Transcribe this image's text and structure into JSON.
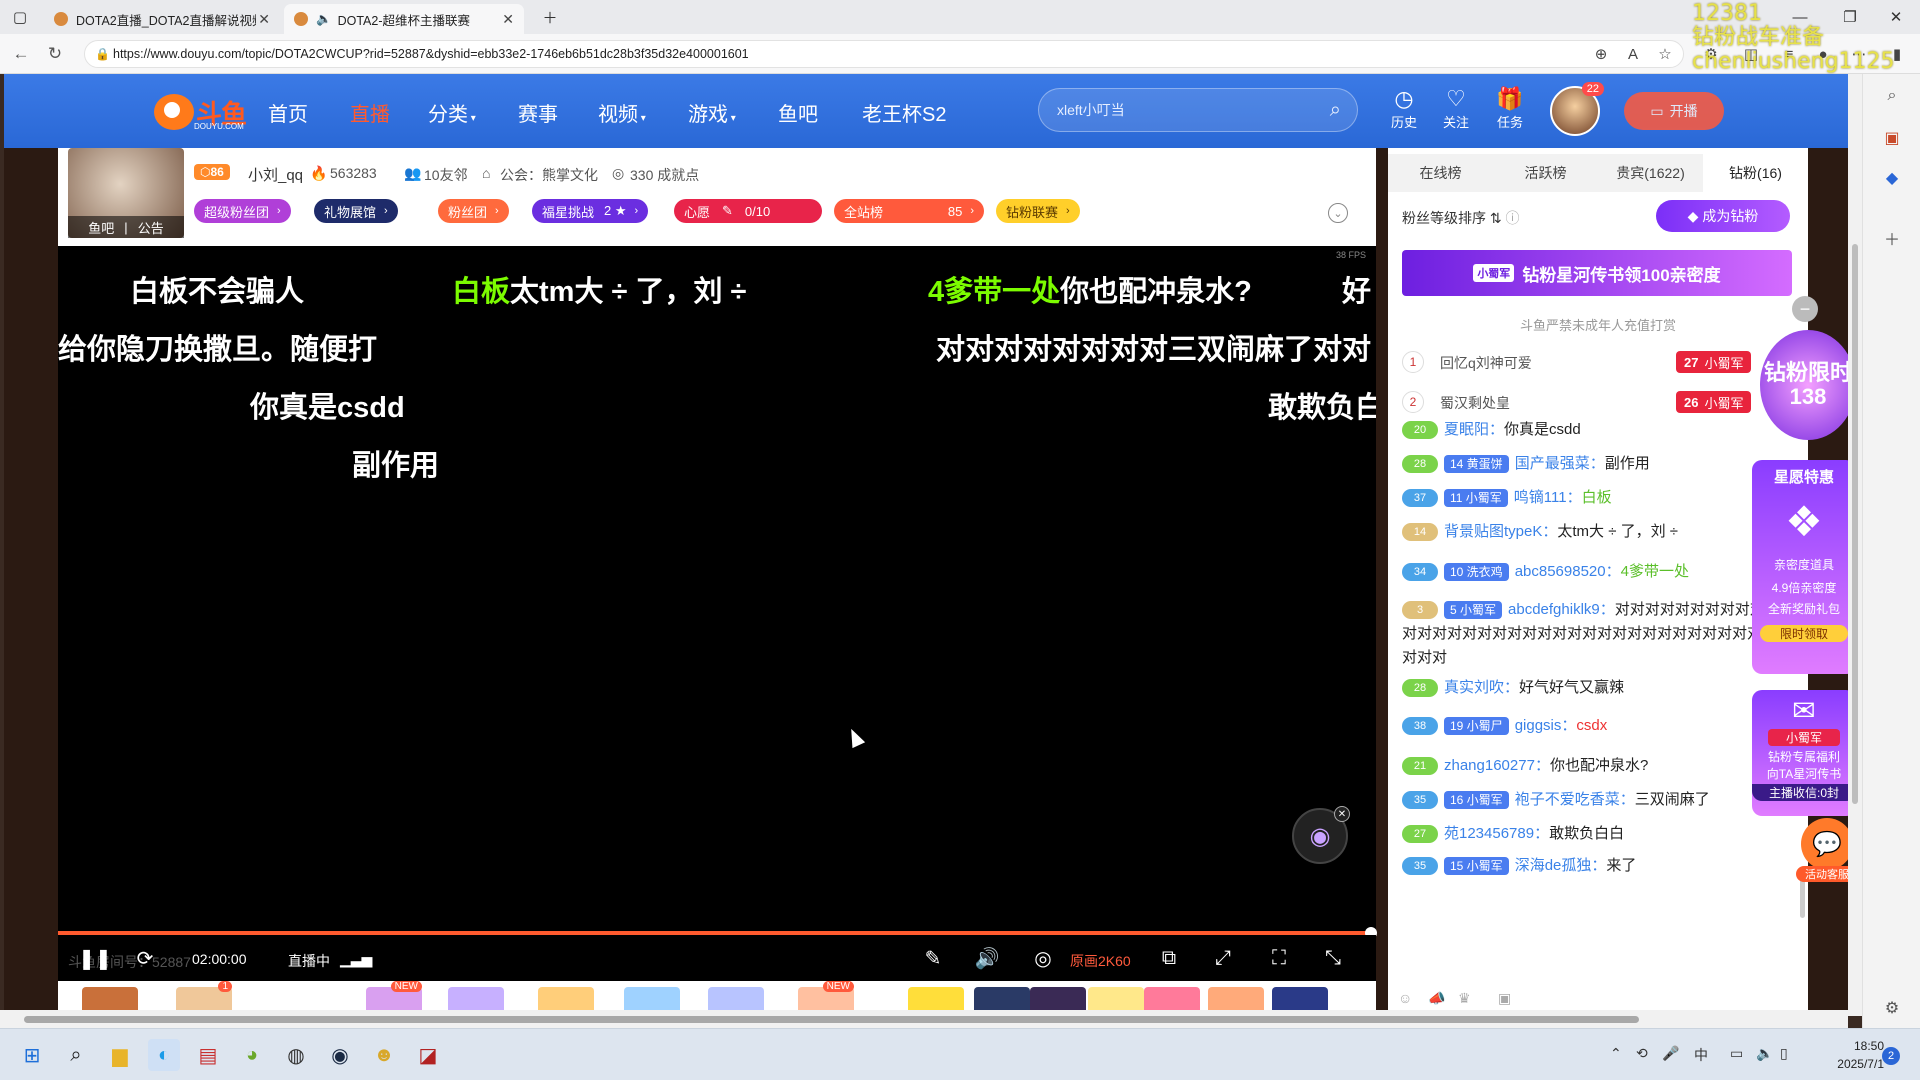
{
  "browser": {
    "tabs": [
      {
        "title": "DOTA2直播_DOTA2直播解说视频",
        "active": false
      },
      {
        "title": "DOTA2-超维杯主播联赛",
        "active": true
      }
    ],
    "url": "https://www.douyu.com/topic/DOTA2CWCUP?rid=52887&dyshid=ebb33e2-1746eb6b51dc28b3f35d32e400001601",
    "overlay_text": [
      "12381",
      "钻粉战车准备",
      "chenliusheng1125"
    ]
  },
  "header": {
    "logo": "斗鱼",
    "logo_sub": "DOUYU.COM",
    "nav": [
      "首页",
      "直播",
      "分类",
      "赛事",
      "视频",
      "游戏",
      "鱼吧",
      "老王杯S2"
    ],
    "active_nav": "直播",
    "search_placeholder": "xleft小叮当",
    "icons": [
      {
        "label": "历史",
        "icon": "clock-icon"
      },
      {
        "label": "关注",
        "icon": "heart-icon"
      },
      {
        "label": "任务",
        "icon": "gift-icon"
      }
    ],
    "avatar_badge": "22",
    "live_button": "开播"
  },
  "room": {
    "avatar_bar": [
      "鱼吧",
      "公告"
    ],
    "level": "86",
    "host": "小刘_qq",
    "hot": "563283",
    "neighbors": "10友邻",
    "guild": "公会：熊掌文化",
    "achievements": "330 成就点",
    "pills": [
      {
        "label": "超级粉丝团",
        "color": "#b03fd8"
      },
      {
        "label": "礼物展馆",
        "color": "#1e2b6a"
      },
      {
        "label": "粉丝团",
        "color": "#ff6a3d"
      },
      {
        "label": "福星挑战",
        "extra": "2 ★",
        "color": "#6b2ee0"
      },
      {
        "label": "心愿",
        "extra": "0/10",
        "color": "#e8244a"
      },
      {
        "label": "全站榜",
        "extra": "85",
        "color": "#ff5a3c"
      },
      {
        "label": "钻粉联赛",
        "color": "#ffcf2a"
      }
    ]
  },
  "video": {
    "fps": "38 FPS",
    "danmaku": [
      {
        "text": "白板不会骗人"
      },
      {
        "highlight": "白板",
        "text": "太tm大 ÷ 了，刘 ÷"
      },
      {
        "highlight": "4爹带一处",
        "text": "你也配冲泉水?"
      },
      {
        "text": "好"
      },
      {
        "text": "给你隐刀换撒旦。随便打"
      },
      {
        "text": "对对对对对对对对三双闹麻了对对"
      },
      {
        "text": "你真是csdd"
      },
      {
        "text": "敢欺负白"
      },
      {
        "text": "副作用"
      }
    ],
    "progress": 0.996
  },
  "controls": {
    "time": "02:00:00",
    "status": "直播中",
    "ghost_text": "斗鱼房间号：52887",
    "quality": "原画2K60"
  },
  "chat": {
    "tabs": [
      "在线榜",
      "活跃榜",
      "贵宾(1622)",
      "钻粉(16)"
    ],
    "active_tab": "钻粉(16)",
    "sort_label": "粉丝等级排序",
    "be_diamond": "成为钻粉",
    "banner": "钻粉星河传书领100亲密度",
    "banner_tag": "小蜀军",
    "notice": "斗鱼严禁未成年人充值打赏",
    "ranks": [
      {
        "no": "1",
        "name": "回忆q刘神可爱",
        "level": "27",
        "tag": "小蜀军"
      },
      {
        "no": "2",
        "name": "蜀汉剩处皇",
        "level": "26",
        "tag": "小蜀军"
      }
    ],
    "messages": [
      {
        "lv": "20",
        "lvcolor": "#7bd34a",
        "user": "夏眠阳",
        "text": "你真是csdd"
      },
      {
        "lv": "28",
        "lvcolor": "#7bd34a",
        "fb": "14 黄蛋饼",
        "user": "国产最强菜",
        "text": "副作用"
      },
      {
        "lv": "37",
        "lvcolor": "#4aa3e8",
        "fb": "11 小蜀军",
        "user": "鸣镝111",
        "text": "白板",
        "tc": "g"
      },
      {
        "lv": "14",
        "lvcolor": "#e0c07a",
        "user": "背景贴图typeK",
        "text": "太tm大 ÷ 了，刘 ÷"
      },
      {
        "lv": "34",
        "lvcolor": "#4aa3e8",
        "fb": "10 洗衣鸡",
        "user": "abc85698520",
        "text": "4爹带一处",
        "tc": "g"
      },
      {
        "lv": "3",
        "lvcolor": "#e0c07a",
        "fb": "5 小蜀军",
        "user": "abcdefghiklk9",
        "text": "对对对对对对对对对对对对对对对对对对对对对对对对对对对对对对对对对对对对对对对对对"
      },
      {
        "lv": "28",
        "lvcolor": "#7bd34a",
        "user": "真实刘吹",
        "text": "好气好气又赢辣"
      },
      {
        "lv": "38",
        "lvcolor": "#4aa3e8",
        "fb": "19 小蜀尸",
        "user": "giggsis",
        "text": "csdx",
        "tc": "r"
      },
      {
        "lv": "21",
        "lvcolor": "#7bd34a",
        "user": "zhang160277",
        "text": "你也配冲泉水?"
      },
      {
        "lv": "35",
        "lvcolor": "#4aa3e8",
        "fb": "16 小蜀军",
        "user": "袍子不爱吃香菜",
        "text": "三双闹麻了"
      },
      {
        "lv": "27",
        "lvcolor": "#7bd34a",
        "user": "苑123456789",
        "text": "敢欺负白白"
      },
      {
        "lv": "35",
        "lvcolor": "#4aa3e8",
        "fb": "15 小蜀军",
        "user": "深海de孤独",
        "text": "来了"
      }
    ],
    "promos": {
      "limit": "钻粉限时138",
      "star": "星愿特惠",
      "intimacy": "亲密度道具",
      "x49": "4.9倍亲密度",
      "gift_pack": "全新奖励礼包",
      "limit_claim": "限时领取",
      "army": "小蜀军",
      "welfare": "钻粉专属福利",
      "star_letter": "向TA星河传书",
      "collect": "主播收信:0封",
      "service": "活动客服"
    }
  },
  "taskbar": {
    "time": "18:50",
    "date": "2025/7/1",
    "notifications": "2"
  }
}
